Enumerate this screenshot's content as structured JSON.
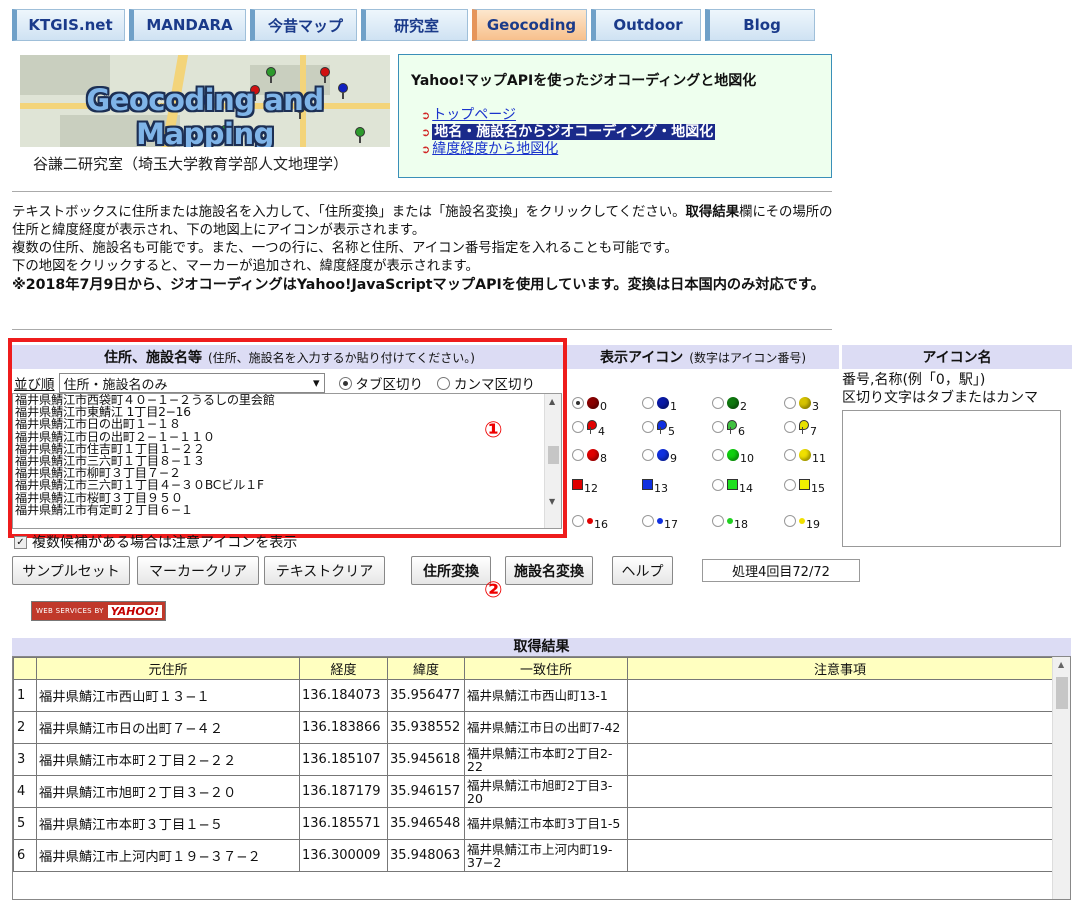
{
  "nav": [
    {
      "label": "KTGIS.net"
    },
    {
      "label": "MANDARA"
    },
    {
      "label": "今昔マップ"
    },
    {
      "label": "研究室"
    },
    {
      "label": "Geocoding",
      "active": true
    },
    {
      "label": "Outdoor"
    },
    {
      "label": "Blog"
    }
  ],
  "banner": {
    "title": "Geocoding and Mapping",
    "caption": "谷謙二研究室（埼玉大学教育学部人文地理学）"
  },
  "infobox": {
    "title": "Yahoo!マップAPIを使ったジオコーディングと地図化",
    "links": [
      "トップページ",
      "地名・施設名からジオコーディング・地図化",
      "緯度経度から地図化"
    ]
  },
  "description": {
    "line1_a": "テキストボックスに住所または施設名を入力して、「住所変換」または「施設名変換」をクリックしてください。",
    "line1_b": "取得結果",
    "line1_c": "欄にその場所の住所と緯度経度が表示され、下の地図上にアイコンが表示されます。",
    "line2": "複数の住所、施設名も可能です。また、一つの行に、名称と住所、アイコン番号指定を入れることも可能です。",
    "line3": "下の地図をクリックすると、マーカーが追加され、緯度経度が表示されます。",
    "note": "※2018年7月9日から、ジオコーディングはYahoo!JavaScriptマップAPIを使用しています。変換は日本国内のみ対応です。"
  },
  "address_panel": {
    "header": "住所、施設名等",
    "header_hint": "(住所、施設名を入力するか貼り付けてください。)",
    "sort_label": "並び順",
    "sort_value": "住所・施設名のみ",
    "radio_tab": "タブ区切り",
    "radio_comma": "カンマ区切り",
    "lines": [
      "福井県鯖江市西袋町４０−１−２うるしの里会館",
      "福井県鯖江市東鯖江 1丁目2−16",
      "福井県鯖江市日の出町１−１８",
      "福井県鯖江市日の出町２−１−１１０",
      "福井県鯖江市住吉町１丁目１−２２",
      "福井県鯖江市三六町１丁目８−１３",
      "福井県鯖江市柳町３丁目７−２",
      "福井県鯖江市三六町１丁目４−３０BCビル１F",
      "福井県鯖江市桜町３丁目９５０",
      "福井県鯖江市有定町２丁目６−１"
    ],
    "marker1": "①",
    "checkbox_label": "複数候補がある場合は注意アイコンを表示"
  },
  "icon_panel": {
    "header": "表示アイコン",
    "header_hint": "(数字はアイコン番号)",
    "icons": [
      {
        "n": "0",
        "kind": "ball",
        "color": "#8b0000",
        "selected": true
      },
      {
        "n": "1",
        "kind": "ball",
        "color": "#0a1aa8"
      },
      {
        "n": "2",
        "kind": "ball",
        "color": "#0f7a0f"
      },
      {
        "n": "3",
        "kind": "ball",
        "color": "#d6c200"
      },
      {
        "n": "4",
        "kind": "flag",
        "color": "#e00000"
      },
      {
        "n": "5",
        "kind": "flag",
        "color": "#1030e0"
      },
      {
        "n": "6",
        "kind": "flag",
        "color": "#40c040"
      },
      {
        "n": "7",
        "kind": "flag",
        "color": "#e6e000"
      },
      {
        "n": "8",
        "kind": "ball",
        "color": "#e00000"
      },
      {
        "n": "9",
        "kind": "ball",
        "color": "#1030e0"
      },
      {
        "n": "10",
        "kind": "ball",
        "color": "#10d010"
      },
      {
        "n": "11",
        "kind": "ball",
        "color": "#f0e000"
      },
      {
        "n": "12",
        "kind": "square",
        "color": "#e00000"
      },
      {
        "n": "13",
        "kind": "square",
        "color": "#1030e0"
      },
      {
        "n": "14",
        "kind": "square",
        "color": "#20e020"
      },
      {
        "n": "15",
        "kind": "square",
        "color": "#f0f000"
      },
      {
        "n": "16",
        "kind": "small",
        "color": "#e00000"
      },
      {
        "n": "17",
        "kind": "small",
        "color": "#1030e0"
      },
      {
        "n": "18",
        "kind": "small",
        "color": "#20d020"
      },
      {
        "n": "19",
        "kind": "small",
        "color": "#f0e000"
      }
    ]
  },
  "iconname_panel": {
    "header": "アイコン名",
    "info1": "番号,名称(例「0，駅」)",
    "info2": "区切り文字はタブまたはカンマ"
  },
  "buttons": {
    "sample": "サンプルセット",
    "marker_clear": "マーカークリア",
    "text_clear": "テキストクリア",
    "address_convert": "住所変換",
    "facility_convert": "施設名変換",
    "help": "ヘルプ",
    "status": "処理4回目72/72",
    "marker2": "②"
  },
  "yahoo": {
    "ws": "WEB SERVICES BY",
    "logo": "YAHOO!"
  },
  "results": {
    "title": "取得結果",
    "columns": [
      "",
      "元住所",
      "経度",
      "緯度",
      "一致住所",
      "注意事項"
    ],
    "rows": [
      [
        "1",
        "福井県鯖江市西山町１３−１",
        "136.184073",
        "35.956477",
        "福井県鯖江市西山町13-1",
        ""
      ],
      [
        "2",
        "福井県鯖江市日の出町７−４２",
        "136.183866",
        "35.938552",
        "福井県鯖江市日の出町7-42",
        ""
      ],
      [
        "3",
        "福井県鯖江市本町２丁目２−２２",
        "136.185107",
        "35.945618",
        "福井県鯖江市本町2丁目2-22",
        ""
      ],
      [
        "4",
        "福井県鯖江市旭町２丁目３−２０",
        "136.187179",
        "35.946157",
        "福井県鯖江市旭町2丁目3-20",
        ""
      ],
      [
        "5",
        "福井県鯖江市本町３丁目１−５",
        "136.185571",
        "35.946548",
        "福井県鯖江市本町3丁目1-5",
        ""
      ],
      [
        "6",
        "福井県鯖江市上河内町１９−３７−２",
        "136.300009",
        "35.948063",
        "福井県鯖江市上河内町19-37−2",
        ""
      ]
    ]
  }
}
